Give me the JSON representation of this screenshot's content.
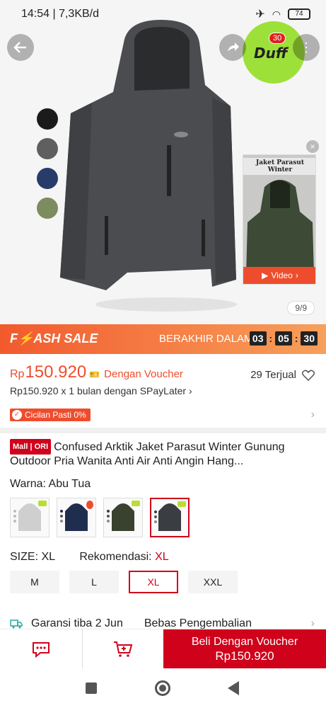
{
  "status_bar": {
    "time": "14:54 | 7,3KB/d",
    "battery": "74"
  },
  "hero": {
    "color_swatches": [
      {
        "name": "black",
        "color": "#1b1b1b"
      },
      {
        "name": "grey",
        "color": "#5f5f5f"
      },
      {
        "name": "navy",
        "color": "#283c6b"
      },
      {
        "name": "olive",
        "color": "#7d8c5e"
      }
    ],
    "cart_count": "30",
    "cart_logo": "Duff",
    "video_card": {
      "title": "Jaket Parasut Winter",
      "button_label": "Video"
    },
    "pager": "9/9"
  },
  "flash_sale": {
    "title": "F⚡ASH SALE",
    "ends_label": "BERAKHIR DALAM",
    "timer": [
      "03",
      "05",
      "30"
    ]
  },
  "price": {
    "currency": "Rp",
    "amount": "150.920",
    "voucher_label": "Dengan Voucher",
    "sold": "29 Terjual",
    "installment": "Rp150.920 x 1 bulan dengan SPayLater",
    "cicilan_badge": "Cicilan Pasti 0%"
  },
  "product": {
    "badge": "Mall | ORI",
    "name": "Confused Arktik Jaket Parasut Winter Gunung Outdoor Pria Wanita Anti Air Anti Angin Hang..."
  },
  "variant": {
    "label": "Warna: Abu Tua",
    "options": [
      {
        "name": "light-grey",
        "color": "#cfcfcf"
      },
      {
        "name": "navy",
        "color": "#1f2d4f"
      },
      {
        "name": "army-green",
        "color": "#39422f"
      },
      {
        "name": "dark-grey",
        "color": "#3a3d41"
      }
    ]
  },
  "size": {
    "label": "SIZE: XL",
    "recommend_label": "Rekomendasi:",
    "recommend_value": "XL",
    "options": [
      "M",
      "L",
      "XL",
      "XXL"
    ],
    "selected": "XL"
  },
  "shipping": {
    "guarantee": "Garansi tiba 2 Jun",
    "returns": "Bebas Pengembalian"
  },
  "bottom_bar": {
    "buy_label": "Beli Dengan Voucher",
    "buy_price": "Rp150.920"
  },
  "colors": {
    "accent": "#ee4d2d",
    "brand_red": "#d0011b"
  }
}
